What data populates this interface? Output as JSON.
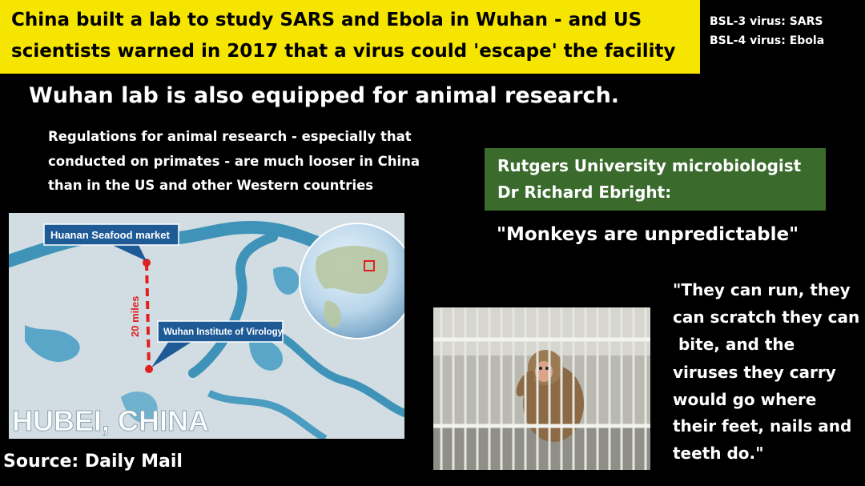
{
  "headline": {
    "line1": "China built a lab to study SARS and Ebola in Wuhan - and US",
    "line2": "scientists warned in 2017 that a virus could 'escape' the facility"
  },
  "bsl": {
    "bsl3": "BSL-3 virus: SARS",
    "bsl4": "BSL-4 virus: Ebola"
  },
  "subheading": "Wuhan lab is also equipped for animal research.",
  "regulations": [
    "Regulations for animal research - especially that",
    "conducted on primates - are much looser in China",
    "than in the US and other Western countries"
  ],
  "expert": {
    "line1": "Rutgers University microbiologist",
    "line2": "Dr Richard Ebright:"
  },
  "quote_main": "\"Monkeys are unpredictable\"",
  "quote_body": [
    "\"They can run, they",
    "can scratch they can",
    " bite, and the",
    "viruses they carry",
    "would go where",
    "their feet, nails and",
    "teeth do.\""
  ],
  "map": {
    "label_market": "Huanan Seafood market",
    "label_institute": "Wuhan Institute of Virology",
    "distance": "20 miles",
    "region": "HUBEI, CHINA"
  },
  "source": "Source: Daily Mail",
  "colors": {
    "headline_bg": "#f5e500",
    "expert_bg": "#3a6b2c",
    "route": "#e02020"
  }
}
